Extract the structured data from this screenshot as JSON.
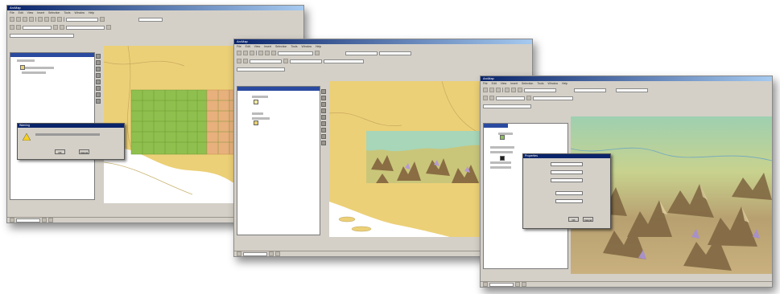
{
  "windows": [
    {
      "title": "ArcMap",
      "menu": [
        "File",
        "Edit",
        "View",
        "Insert",
        "Selection",
        "Tools",
        "Window",
        "Help"
      ],
      "dialog": {
        "title": "Warning",
        "message": "",
        "buttons": [
          "OK",
          "Cancel"
        ]
      }
    },
    {
      "title": "ArcMap",
      "menu": [
        "File",
        "Edit",
        "View",
        "Insert",
        "Selection",
        "Tools",
        "Window",
        "Help"
      ]
    },
    {
      "title": "ArcMap",
      "menu": [
        "File",
        "Edit",
        "View",
        "Insert",
        "Selection",
        "Tools",
        "Window",
        "Help"
      ],
      "dialog": {
        "title": "Properties",
        "buttons": [
          "OK",
          "Cancel"
        ]
      }
    }
  ],
  "colors": {
    "land": "#ecd077",
    "sea": "#ffffff",
    "grid_green": "#8fbf4e",
    "grid_orange": "#e8b07c",
    "title_blue": "#0a246a",
    "chrome": "#d4d0c8"
  }
}
